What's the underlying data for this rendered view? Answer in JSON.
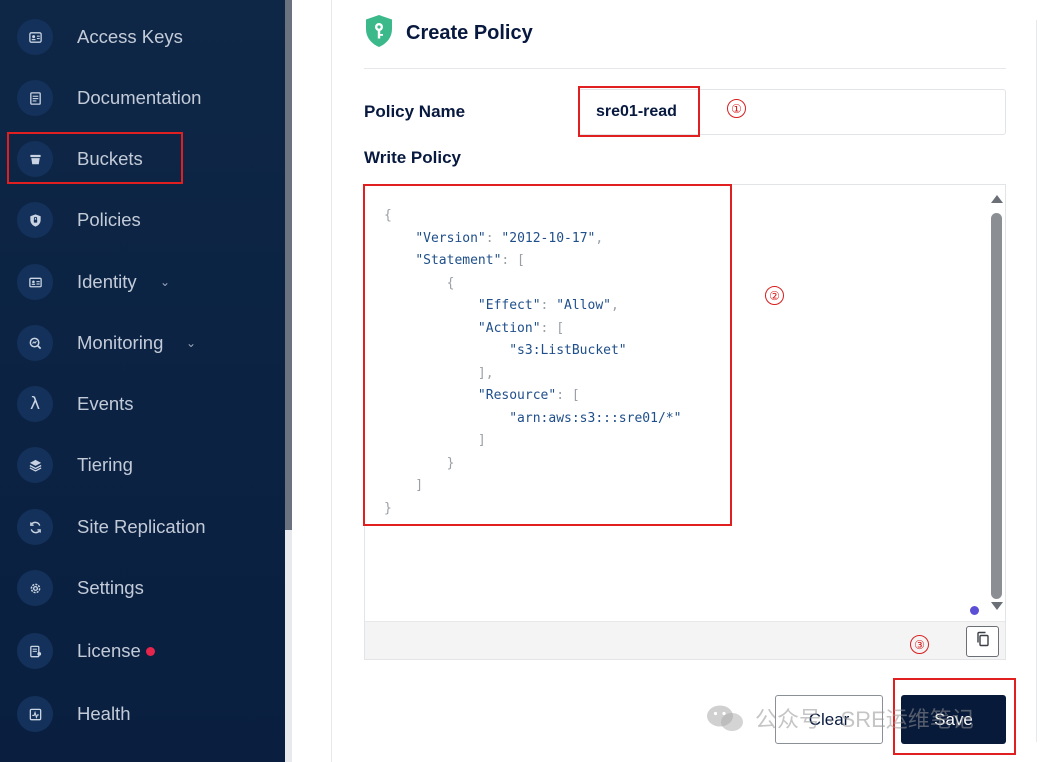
{
  "sidebar": {
    "items": [
      {
        "label": "Access Keys",
        "icon": "key-card-icon"
      },
      {
        "label": "Documentation",
        "icon": "document-icon"
      },
      {
        "label": "Buckets",
        "icon": "bucket-icon"
      },
      {
        "label": "Policies",
        "icon": "shield-icon"
      },
      {
        "label": "Identity",
        "icon": "id-card-icon",
        "chevron": "⌄"
      },
      {
        "label": "Monitoring",
        "icon": "magnifier-chart-icon",
        "chevron": "⌄"
      },
      {
        "label": "Events",
        "icon": "lambda-icon",
        "glyph": "λ"
      },
      {
        "label": "Tiering",
        "icon": "layers-icon"
      },
      {
        "label": "Site Replication",
        "icon": "replication-icon"
      },
      {
        "label": "Settings",
        "icon": "gear-icon"
      },
      {
        "label": "License",
        "icon": "license-icon"
      },
      {
        "label": "Health",
        "icon": "health-icon"
      }
    ]
  },
  "page": {
    "title": "Create Policy",
    "policy_name_label": "Policy Name",
    "policy_name_value": "sre01-read",
    "write_policy_label": "Write Policy"
  },
  "editor": {
    "lines": [
      "{",
      "    \"Version\": \"2012-10-17\",",
      "    \"Statement\": [",
      "        {",
      "            \"Effect\": \"Allow\",",
      "            \"Action\": [",
      "                \"s3:ListBucket\"",
      "            ],",
      "            \"Resource\": [",
      "                \"arn:aws:s3:::sre01/*\"",
      "            ]",
      "        }",
      "    ]",
      "}"
    ]
  },
  "annotations": {
    "marker1": "①",
    "marker2": "②",
    "marker3": "③"
  },
  "actions": {
    "clear_label": "Clear",
    "save_label": "Save"
  },
  "watermark": {
    "text": "公众号 · SRE运维笔记"
  },
  "colors": {
    "sidebar_bg": "#0b2243",
    "primary_text": "#07193e",
    "save_button": "#081a3a",
    "license_dot": "#e5254b",
    "annotation_red": "#e02020"
  }
}
